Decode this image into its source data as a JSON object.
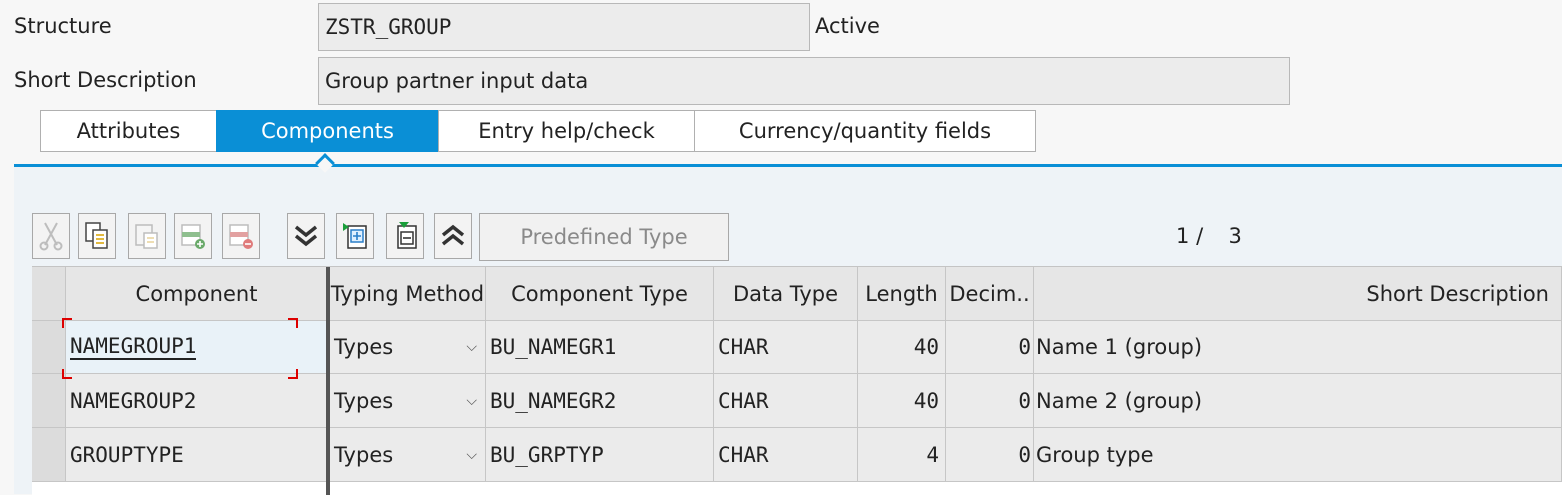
{
  "header": {
    "structure_label": "Structure",
    "structure_value": "ZSTR_GROUP",
    "status": "Active",
    "short_desc_label": "Short Description",
    "short_desc_value": "Group partner input data"
  },
  "tabs": [
    {
      "label": "Attributes",
      "active": false
    },
    {
      "label": "Components",
      "active": true
    },
    {
      "label": "Entry help/check",
      "active": false
    },
    {
      "label": "Currency/quantity fields",
      "active": false
    }
  ],
  "toolbar": {
    "icons": [
      "cut-icon",
      "copy-icon",
      "paste-icon",
      "insert-row-icon",
      "delete-row-icon",
      "expand-all-icon",
      "insert-include-icon",
      "remove-include-icon",
      "collapse-all-icon"
    ],
    "predefined_type_label": "Predefined Type",
    "pager_current": "1",
    "pager_sep": "/",
    "pager_total": "3"
  },
  "table": {
    "columns": [
      "Component",
      "Typing Method",
      "Component Type",
      "Data Type",
      "Length",
      "Decim..",
      "Short Description"
    ],
    "rows": [
      {
        "component": "NAMEGROUP1",
        "typing": "Types",
        "comp_type": "BU_NAMEGR1",
        "data_type": "CHAR",
        "length": "40",
        "decimals": "0",
        "desc": "Name 1 (group)"
      },
      {
        "component": "NAMEGROUP2",
        "typing": "Types",
        "comp_type": "BU_NAMEGR2",
        "data_type": "CHAR",
        "length": "40",
        "decimals": "0",
        "desc": "Name 2 (group)"
      },
      {
        "component": "GROUPTYPE",
        "typing": "Types",
        "comp_type": "BU_GRPTYP",
        "data_type": "CHAR",
        "length": "4",
        "decimals": "0",
        "desc": "Group type"
      }
    ]
  },
  "colors": {
    "accent": "#0a8fd6",
    "focus": "#cc0000"
  }
}
